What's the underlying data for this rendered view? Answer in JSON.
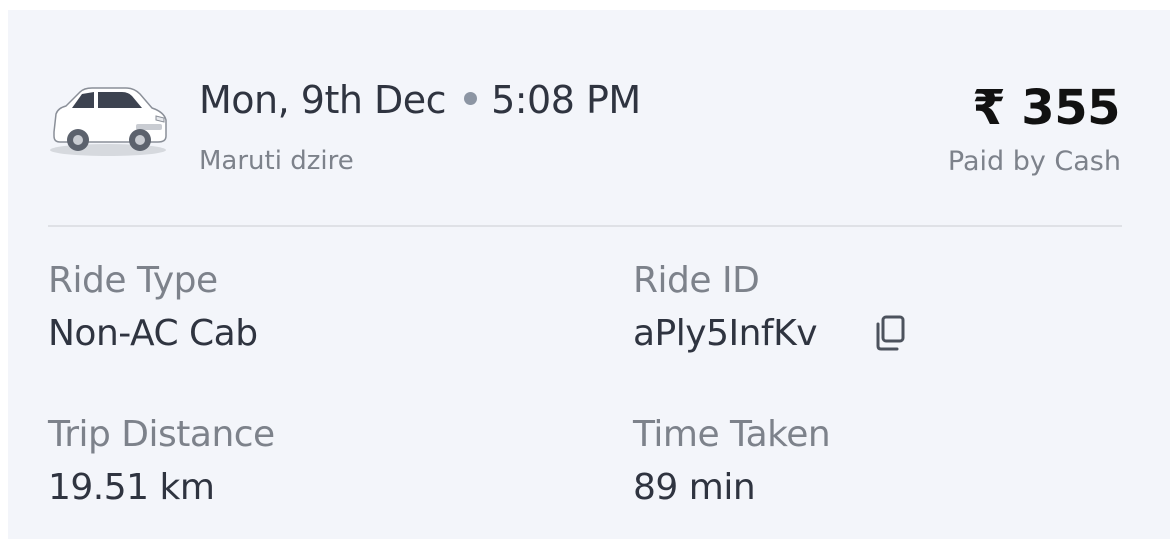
{
  "ride": {
    "date": "Mon, 9th Dec",
    "time": "5:08 PM",
    "car_model": "Maruti dzire",
    "fare": "₹ 355",
    "payment": "Paid by Cash"
  },
  "details": {
    "ride_type_label": "Ride Type",
    "ride_type_value": "Non-AC Cab",
    "ride_id_label": "Ride ID",
    "ride_id_value": "aPly5InfKv",
    "distance_label": "Trip Distance",
    "distance_value": "19.51 km",
    "time_label": "Time Taken",
    "time_value": "89 min"
  },
  "icons": {
    "car": "car-illustration",
    "copy": "copy-icon"
  },
  "colors": {
    "card_bg": "#f3f5fa",
    "primary_text": "#2f3440",
    "secondary_text": "#7d828b"
  }
}
